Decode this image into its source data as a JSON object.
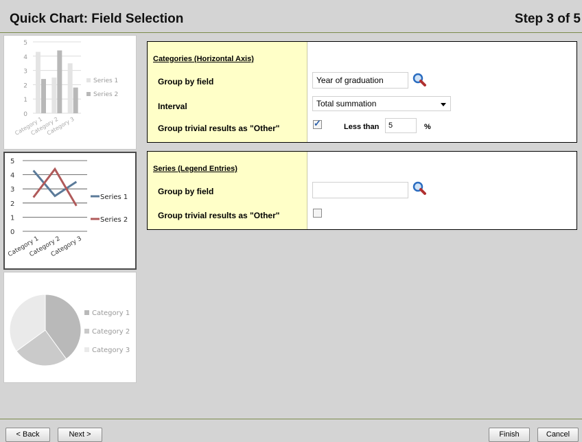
{
  "header": {
    "title": "Quick Chart: Field Selection",
    "step": "Step 3 of 5"
  },
  "thumbnails": {
    "bar": {
      "yticks": [
        "5",
        "4",
        "3",
        "2",
        "1",
        "0"
      ],
      "categories": [
        "Category 1",
        "Category 2",
        "Category 3"
      ],
      "legend": [
        "Series 1",
        "Series 2"
      ],
      "series1": [
        4.3,
        2.5,
        3.5
      ],
      "series2": [
        2.4,
        4.4,
        1.8
      ]
    },
    "line": {
      "yticks": [
        "5",
        "4",
        "3",
        "2",
        "1",
        "0"
      ],
      "categories": [
        "Category 1",
        "Category 2",
        "Category 3"
      ],
      "legend": [
        "Series 1",
        "Series 2"
      ],
      "series1": [
        4.3,
        2.5,
        3.5
      ],
      "series2": [
        2.4,
        4.4,
        1.8
      ],
      "colors": {
        "series1": "#5b7a99",
        "series2": "#b05a5a"
      }
    },
    "pie": {
      "legend": [
        "Category 1",
        "Category 2",
        "Category 3"
      ],
      "values": [
        40,
        25,
        35
      ]
    }
  },
  "categories_panel": {
    "heading": "Categories (Horizontal Axis)",
    "group_by_label": "Group by field",
    "group_by_value": "Year of graduation",
    "interval_label": "Interval",
    "interval_value": "Total summation",
    "trivial_label": "Group trivial results as \"Other\"",
    "trivial_checked": true,
    "less_than_label": "Less than",
    "less_than_value": "5",
    "percent": "%"
  },
  "series_panel": {
    "heading": "Series (Legend Entries)",
    "group_by_label": "Group by field",
    "group_by_value": "",
    "trivial_label": "Group trivial results as \"Other\"",
    "trivial_checked": false
  },
  "footer": {
    "back": "< Back",
    "next": "Next >",
    "finish": "Finish",
    "cancel": "Cancel"
  }
}
